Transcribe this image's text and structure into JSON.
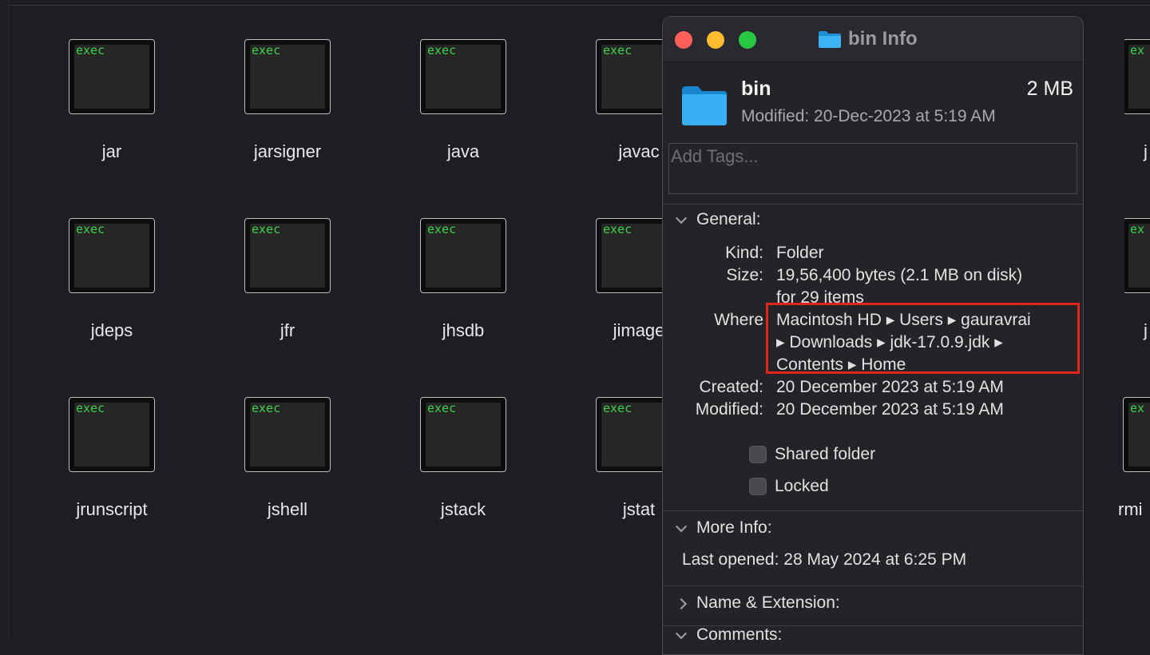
{
  "files": [
    {
      "name": "jar",
      "badge": "exec"
    },
    {
      "name": "jarsigner",
      "badge": "exec"
    },
    {
      "name": "java",
      "badge": "exec"
    },
    {
      "name": "javac",
      "badge": "exec"
    },
    {
      "name": "jdeps",
      "badge": "exec"
    },
    {
      "name": "jfr",
      "badge": "exec"
    },
    {
      "name": "jhsdb",
      "badge": "exec"
    },
    {
      "name": "jimage",
      "badge": "exec"
    },
    {
      "name": "jrunscript",
      "badge": "exec"
    },
    {
      "name": "jshell",
      "badge": "exec"
    },
    {
      "name": "jstack",
      "badge": "exec"
    },
    {
      "name": "jstat",
      "badge": "exec"
    }
  ],
  "right_partial": [
    {
      "name": "j",
      "badge": "ex"
    },
    {
      "name": "j",
      "badge": "ex"
    },
    {
      "name": "rmi",
      "badge": "ex"
    }
  ],
  "info": {
    "window_title": "bin Info",
    "name": "bin",
    "size": "2 MB",
    "modified_header": "Modified: 20-Dec-2023 at 5:19 AM",
    "tags_placeholder": "Add Tags...",
    "general": {
      "heading": "General:",
      "kind_label": "Kind:",
      "kind_value": "Folder",
      "size_label": "Size:",
      "size_line1": "19,56,400 bytes (2.1 MB on disk)",
      "size_line2": "for 29 items",
      "where_label": "Where",
      "where_line1": "Macintosh HD ▸ Users ▸ gauravrai",
      "where_line2": "▸ Downloads ▸ jdk-17.0.9.jdk ▸",
      "where_line3": "Contents ▸ Home",
      "created_label": "Created:",
      "created_value": "20 December 2023 at 5:19 AM",
      "modified_label": "Modified:",
      "modified_value": "20 December 2023 at 5:19 AM",
      "shared_folder": "Shared folder",
      "locked": "Locked"
    },
    "more_info": {
      "heading": "More Info:",
      "last_opened_label": "Last opened:",
      "last_opened_value": "28 May 2024 at 6:25 PM"
    },
    "name_extension_heading": "Name & Extension:",
    "comments_heading": "Comments:"
  },
  "colors": {
    "background": "#1e1d24",
    "exec_text": "#3fd14a",
    "folder_blue": "#29a8f0",
    "highlight_red": "#e1251b",
    "close": "#fe5f57",
    "minimize": "#febc2e",
    "zoom": "#28c840"
  }
}
